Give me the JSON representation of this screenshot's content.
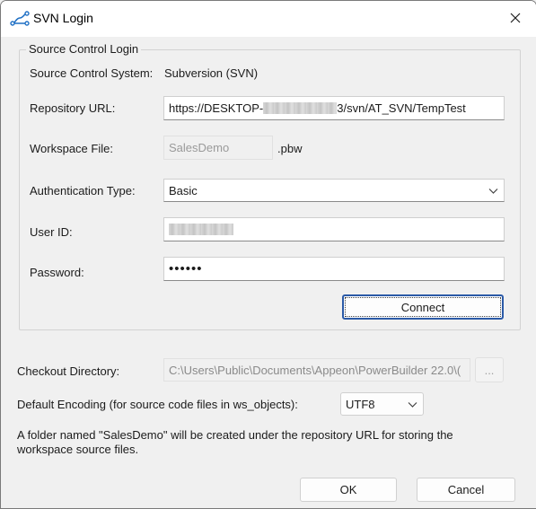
{
  "window": {
    "title": "SVN Login",
    "app_icon": "svn-branch-icon",
    "close_icon": "close-icon"
  },
  "source_control_group": {
    "legend": "Source Control Login",
    "system_label": "Source Control System:",
    "system_value": "Subversion (SVN)",
    "repository_label": "Repository URL:",
    "repository_prefix": "https://DESKTOP-",
    "repository_suffix": "3/svn/AT_SVN/TempTest",
    "workspace_label": "Workspace File:",
    "workspace_value": "SalesDemo",
    "workspace_ext": ".pbw",
    "auth_label": "Authentication Type:",
    "auth_value": "Basic",
    "userid_label": "User ID:",
    "password_label": "Password:",
    "password_value": "••••••",
    "connect_label": "Connect"
  },
  "checkout": {
    "label": "Checkout Directory:",
    "value": "C:\\Users\\Public\\Documents\\Appeon\\PowerBuilder 22.0\\(",
    "browse_label": "..."
  },
  "encoding": {
    "label": "Default Encoding (for source code files in ws_objects):",
    "value": "UTF8"
  },
  "note": {
    "line1": "A folder named \"SalesDemo\" will be created under the repository URL for storing the",
    "line2": "workspace source files."
  },
  "footer": {
    "ok_label": "OK",
    "cancel_label": "Cancel"
  },
  "colors": {
    "accent": "#2b5aa7",
    "icon_blue": "#1e6fc4"
  }
}
